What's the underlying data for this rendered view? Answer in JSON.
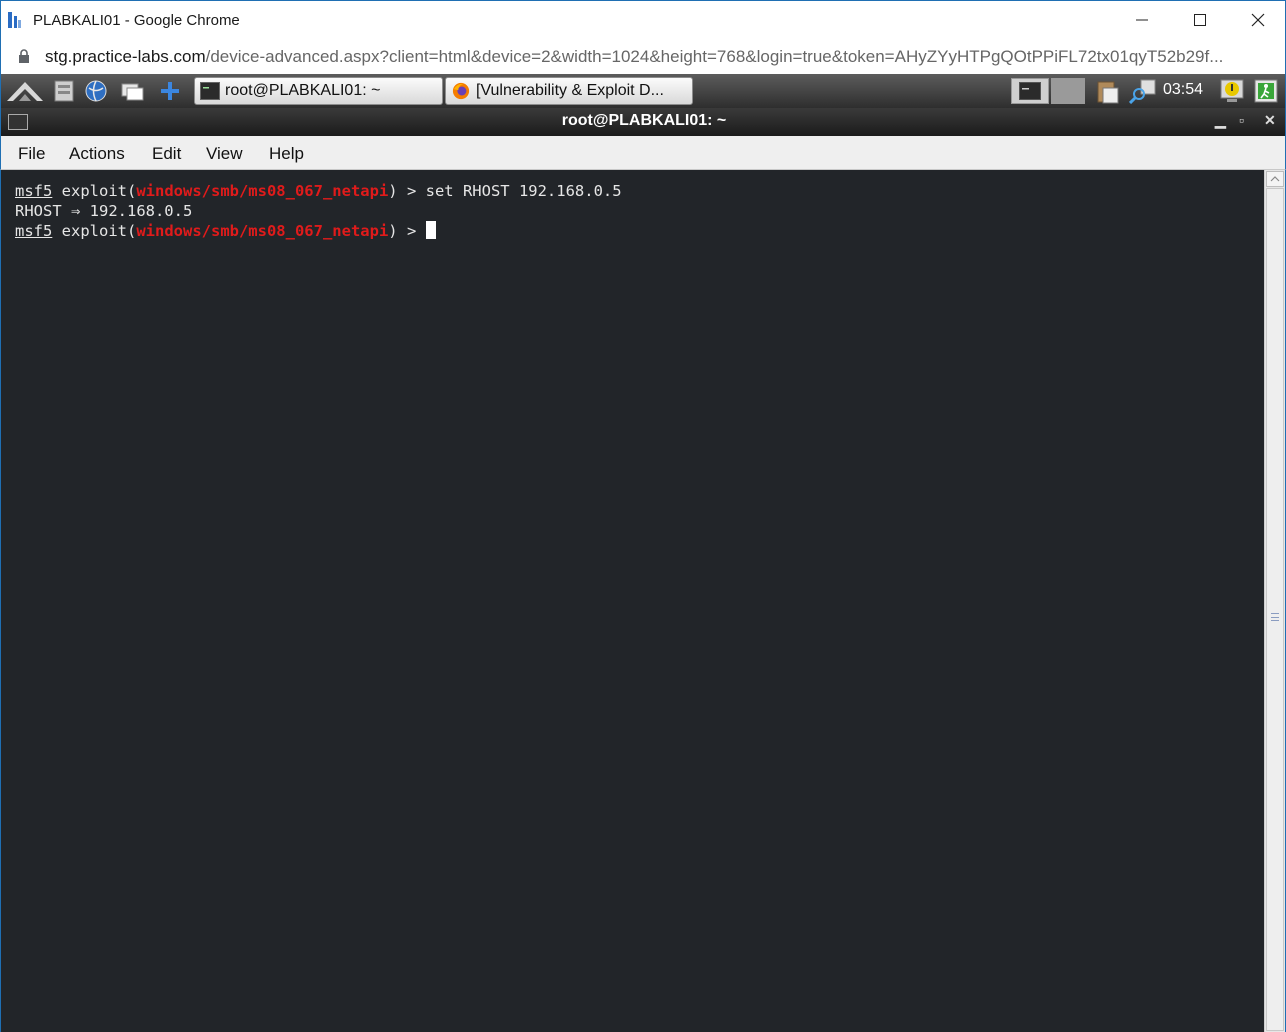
{
  "browser": {
    "window_title": "PLABKALI01 - Google Chrome",
    "url_domain": "stg.practice-labs.com",
    "url_path": "/device-advanced.aspx?client=html&device=2&width=1024&height=768&login=true&token=AHyZYyHTPgQOtPPiFL72tx01qyT52b29f..."
  },
  "panel": {
    "tasks": [
      {
        "label": "root@PLABKALI01: ~",
        "icon": "terminal-icon"
      },
      {
        "label": "[Vulnerability & Exploit D...",
        "icon": "firefox-icon"
      }
    ],
    "clock": "03:54"
  },
  "terminal": {
    "title": "root@PLABKALI01: ~",
    "menu": [
      "File",
      "Actions",
      "Edit",
      "View",
      "Help"
    ],
    "lines": [
      {
        "prompt": "msf5",
        "pre": " exploit(",
        "module": "windows/smb/ms08_067_netapi",
        "post": ") > set RHOST 192.168.0.5"
      },
      {
        "text": "RHOST ⇒ 192.168.0.5"
      },
      {
        "prompt": "msf5",
        "pre": " exploit(",
        "module": "windows/smb/ms08_067_netapi",
        "post": ") > "
      }
    ]
  },
  "colors": {
    "terminal_bg": "#222529",
    "module_red": "#e01b1b",
    "accent_blue": "#1f6fb3"
  }
}
